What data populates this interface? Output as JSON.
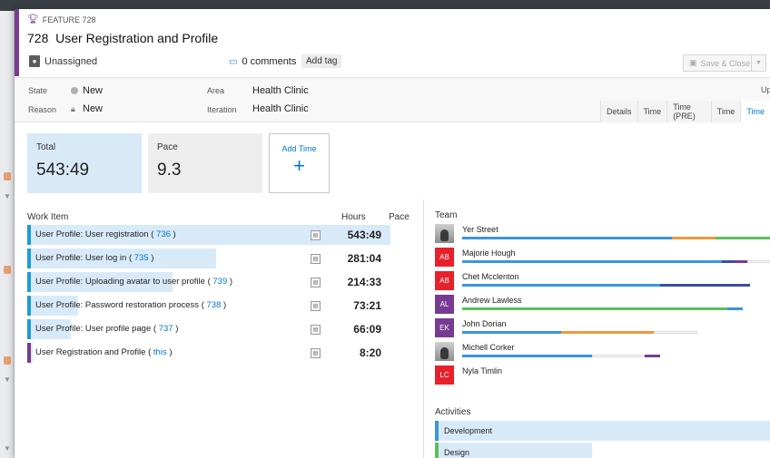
{
  "feature": {
    "type_label": "FEATURE 728",
    "id": "728",
    "title": "User Registration and Profile"
  },
  "header": {
    "assigned": "Unassigned",
    "comments": "0 comments",
    "add_tag": "Add tag",
    "save_close": "Save & Close"
  },
  "fields": {
    "state_label": "State",
    "state_value": "New",
    "reason_label": "Reason",
    "reason_value": "New",
    "area_label": "Area",
    "area_value": "Health Clinic",
    "iteration_label": "Iteration",
    "iteration_value": "Health Clinic",
    "up_label": "Up"
  },
  "tabs": [
    "Details",
    "Time",
    "Time (PRE)",
    "Time",
    "Time"
  ],
  "tiles": {
    "total_label": "Total",
    "total_value": "543:49",
    "pace_label": "Pace",
    "pace_value": "9.3",
    "add_label": "Add Time",
    "add_symbol": "+"
  },
  "work_items": {
    "headers": {
      "item": "Work Item",
      "hours": "Hours",
      "pace": "Pace"
    },
    "rows": [
      {
        "text": "User Profile: User registration",
        "open": "(",
        "id": "736",
        "close": ")",
        "hours": "543:49",
        "fill": 1.0,
        "accent": "#1e9bd4"
      },
      {
        "text": "User Profile: User log in",
        "open": "(",
        "id": "735",
        "close": ")",
        "hours": "281:04",
        "fill": 0.52,
        "accent": "#1e9bd4"
      },
      {
        "text": "User Profile: Uploading avatar to user profile",
        "open": "(",
        "id": "739",
        "close": ")",
        "hours": "214:33",
        "fill": 0.4,
        "accent": "#1e9bd4"
      },
      {
        "text": "User Profile: Password restoration process",
        "open": "(",
        "id": "738",
        "close": ")",
        "hours": "73:21",
        "fill": 0.14,
        "accent": "#1e9bd4"
      },
      {
        "text": "User Profile: User profile page",
        "open": "(",
        "id": "737",
        "close": ")",
        "hours": "66:09",
        "fill": 0.12,
        "accent": "#1e9bd4"
      },
      {
        "text": "User Registration and Profile",
        "open": "(",
        "id": "this",
        "close": ")",
        "hours": "8:20",
        "fill": 0.015,
        "accent": "#773b93"
      }
    ]
  },
  "team": {
    "label": "Team",
    "members": [
      {
        "name": "Yer Street",
        "initials": "",
        "photo": true,
        "color": "#444",
        "bar": [
          [
            "#3a96dd",
            0.68
          ],
          [
            "#f0983d",
            0.14
          ],
          [
            "#5ec05a",
            0.3
          ],
          [
            "#3a4fa0",
            0.03
          ]
        ]
      },
      {
        "name": "Majorie Hough",
        "initials": "AB",
        "photo": false,
        "color": "#e8202a",
        "bar": [
          [
            "#3a96dd",
            0.84
          ],
          [
            "#3a4fa0",
            0.04
          ],
          [
            "#773b93",
            0.04
          ],
          [
            "#ffffff",
            0.08
          ]
        ]
      },
      {
        "name": "Chet Mcclenton",
        "initials": "AB",
        "photo": false,
        "color": "#e8202a",
        "bar": [
          [
            "#3a96dd",
            0.64
          ],
          [
            "#3a4fa0",
            0.29
          ]
        ]
      },
      {
        "name": "Andrew Lawless",
        "initials": "AL",
        "photo": false,
        "color": "#773b93",
        "bar": [
          [
            "#5ec05a",
            0.86
          ],
          [
            "#3a96dd",
            0.05
          ]
        ]
      },
      {
        "name": "John Dorian",
        "initials": "EK",
        "photo": false,
        "color": "#773b93",
        "bar": [
          [
            "#3a96dd",
            0.32
          ],
          [
            "#f0983d",
            0.3
          ],
          [
            "#ffffff",
            0.14
          ]
        ]
      },
      {
        "name": "Michell Corker",
        "initials": "",
        "photo": true,
        "color": "#444",
        "bar": [
          [
            "#3a96dd",
            0.42
          ],
          [
            "#ffffff",
            0.17
          ],
          [
            "#773b93",
            0.05
          ]
        ]
      },
      {
        "name": "Nyla Timlin",
        "initials": "LC",
        "photo": false,
        "color": "#e8202a",
        "bar": []
      }
    ]
  },
  "activities": {
    "label": "Activities",
    "items": [
      {
        "name": "Development",
        "fill": 1.0,
        "accent": "#3a96dd"
      },
      {
        "name": "Design",
        "fill": 0.47,
        "accent": "#5ec05a"
      }
    ]
  },
  "colors": {
    "accent": "#773b93",
    "link": "#0078d4",
    "tile_total": "#d8eaf8"
  }
}
